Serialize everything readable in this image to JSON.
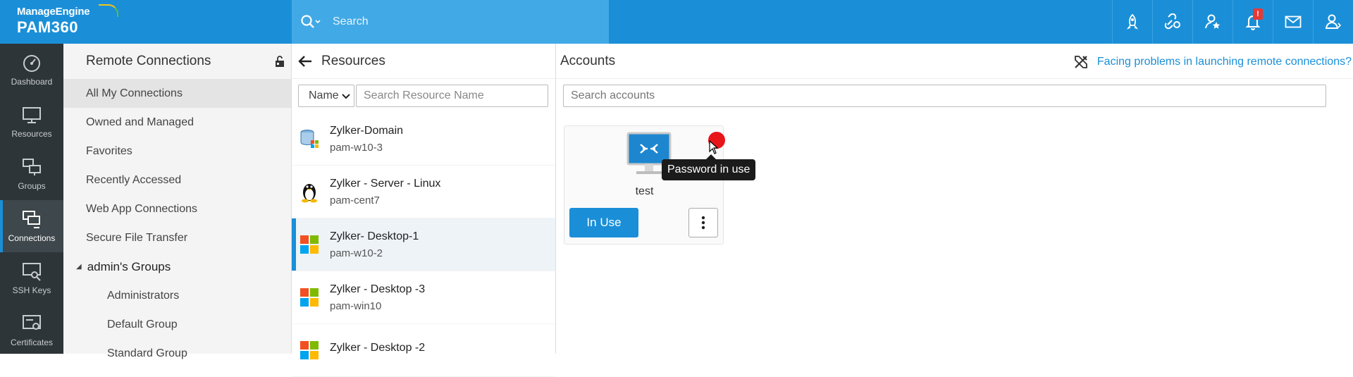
{
  "brand": {
    "company": "ManageEngine",
    "product": "PAM360"
  },
  "search": {
    "placeholder": "Search"
  },
  "top_icons": [
    "rocket-icon",
    "link-settings-icon",
    "user-star-icon",
    "bell-icon",
    "mail-icon",
    "user-icon"
  ],
  "notification_badge": "!",
  "nav": [
    {
      "label": "Dashboard",
      "icon": "gauge-icon"
    },
    {
      "label": "Resources",
      "icon": "monitor-icon"
    },
    {
      "label": "Groups",
      "icon": "groups-icon"
    },
    {
      "label": "Connections",
      "icon": "connections-icon",
      "active": true
    },
    {
      "label": "SSH Keys",
      "icon": "key-icon"
    },
    {
      "label": "Certificates",
      "icon": "certificate-icon"
    }
  ],
  "remote_connections": {
    "title": "Remote Connections",
    "items": [
      "All My Connections",
      "Owned and Managed",
      "Favorites",
      "Recently Accessed",
      "Web App Connections",
      "Secure File Transfer"
    ],
    "group_label": "admin's Groups",
    "groups": [
      "Administrators",
      "Default Group",
      "Standard Group"
    ]
  },
  "resources": {
    "title": "Resources",
    "filter_select": "Name",
    "search_placeholder": "Search Resource Name",
    "rows": [
      {
        "name": "Zylker-Domain",
        "host": "pam-w10-3",
        "icon": "domain-icon"
      },
      {
        "name": "Zylker - Server - Linux",
        "host": "pam-cent7",
        "icon": "linux-icon"
      },
      {
        "name": "Zylker- Desktop-1",
        "host": "pam-w10-2",
        "icon": "windows-icon"
      },
      {
        "name": "Zylker - Desktop -3",
        "host": "pam-win10",
        "icon": "windows-icon"
      },
      {
        "name": "Zylker - Desktop -2",
        "host": "",
        "icon": "windows-icon"
      }
    ]
  },
  "accounts": {
    "title": "Accounts",
    "help_link": "Facing problems in launching remote connections?",
    "search_placeholder": "Search accounts",
    "card": {
      "name": "test",
      "button": "In Use",
      "tooltip": "Password in use"
    }
  },
  "colors": {
    "brand_blue": "#1a8fd8",
    "sidebar": "#2e3538",
    "status_red": "#e8151b"
  }
}
